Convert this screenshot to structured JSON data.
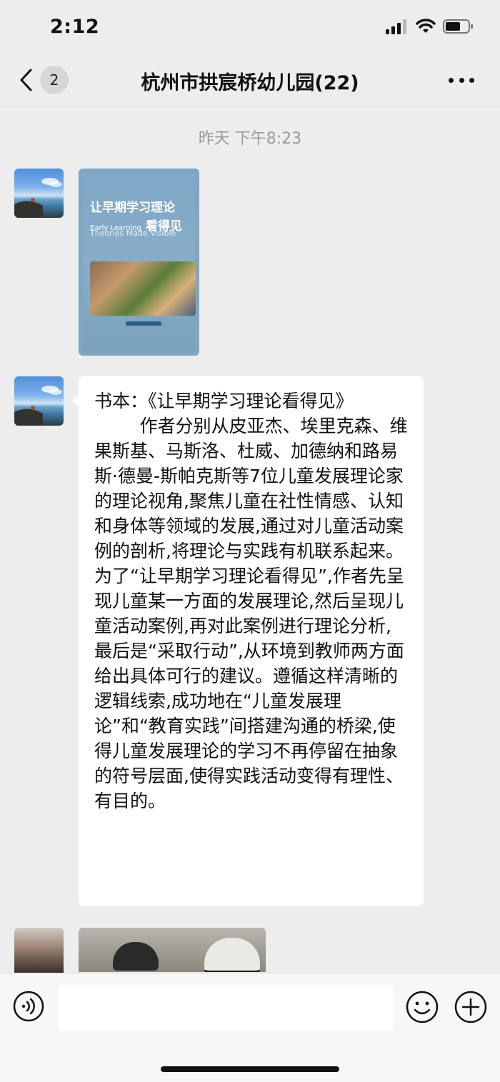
{
  "status_bar": {
    "time": "2:12"
  },
  "nav": {
    "back_badge": "2",
    "title": "杭州市拱宸桥幼儿园(22)"
  },
  "chat": {
    "timestamp": "昨天 下午8:23",
    "book_cover": {
      "title": "让早期学习理论",
      "subtitle_en": "Early Learning",
      "subtitle_cn": "看得见",
      "subtitle_en2": "Theories Made Visible"
    },
    "text_message": "书本：《让早期学习理论看得见》\n        作者分别从皮亚杰、埃里克森、维果斯基、马斯洛、杜威、加德纳和路易斯·德曼-斯帕克斯等7位儿童发展理论家的理论视角,聚焦儿童在社性情感、认知和身体等领域的发展,通过对儿童活动案例的剖析,将理论与实践有机联系起来。为了“让早期学习理论看得见”,作者先呈现儿童某一方面的发展理论,然后呈现儿童活动案例,再对此案例进行理论分析,最后是“采取行动”,从环境到教师两方面给出具体可行的建议。遵循这样清晰的逻辑线索,成功地在“儿童发展理论”和“教育实践”间搭建沟通的桥梁,使得儿童发展理论的学习不再停留在抽象的符号层面,使得实践活动变得有理性、有目的。"
  },
  "input_bar": {
    "input_value": ""
  },
  "icons": {
    "back": "chevron-left-icon",
    "more": "more-dots-icon",
    "voice": "voice-icon",
    "emoji": "emoji-icon",
    "plus": "plus-icon"
  },
  "colors": {
    "background": "#ededed",
    "bubble": "#ffffff",
    "timestamp": "#9a9a9a"
  }
}
